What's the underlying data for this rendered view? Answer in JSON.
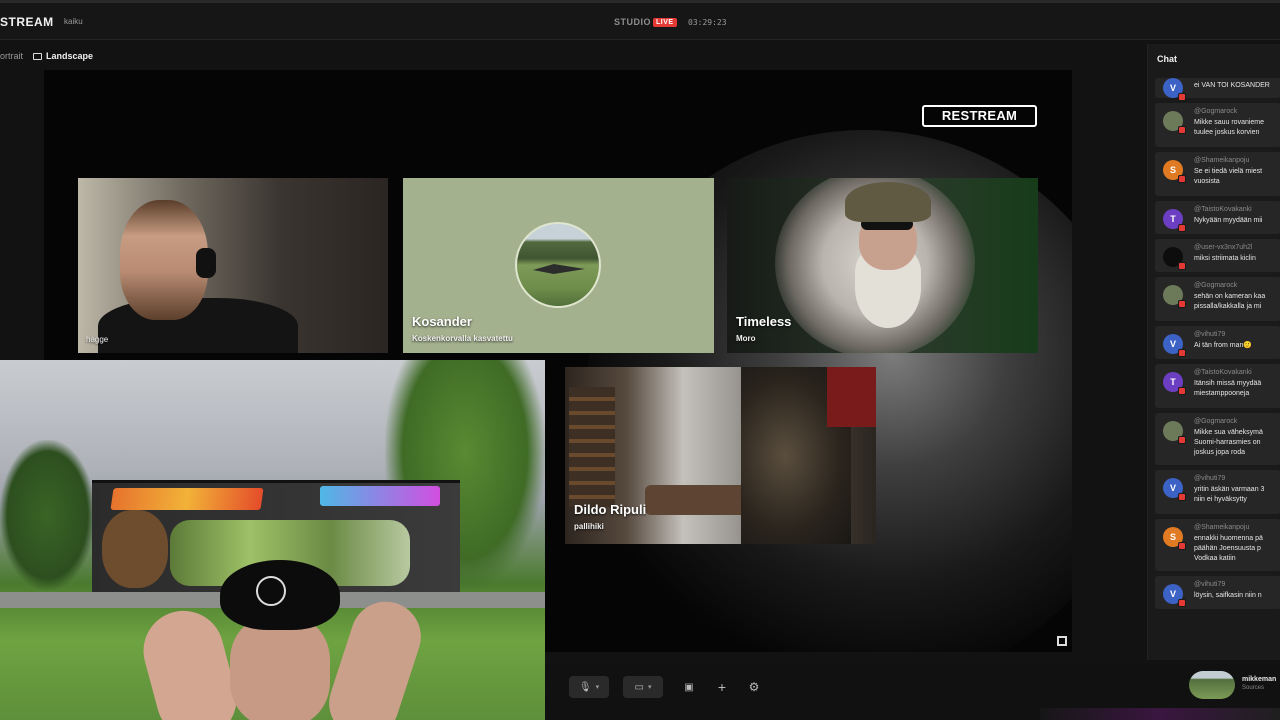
{
  "header": {
    "brand": "STREAM",
    "channel": "kaiku",
    "studio_label": "STUDIO",
    "live_badge": "LIVE",
    "timer": "03:29:23"
  },
  "layout_toggle": {
    "portrait_label": "ortrait",
    "landscape_label": "Landscape",
    "selected": "Landscape"
  },
  "stage": {
    "watermark": "RESTREAM",
    "participants": [
      {
        "name": "hagge",
        "subtitle": ""
      },
      {
        "name": "Kosander",
        "subtitle": "Koskenkorvalla kasvatettu"
      },
      {
        "name": "Timeless",
        "subtitle": "Moro"
      },
      {
        "name": "Dildo Ripuli",
        "subtitle": "pallihiki"
      }
    ]
  },
  "controls": {
    "mic_icon": "microphone-icon",
    "camera_icon": "camera-icon",
    "share_icon": "screen-share-icon",
    "add_icon": "plus-icon",
    "settings_icon": "gear-icon"
  },
  "chat": {
    "title": "Chat",
    "messages": [
      {
        "user": "",
        "text": "ei VAN TOI KOSANDER",
        "avatar": "V",
        "color": "#3b62c4"
      },
      {
        "user": "@Gogmarock",
        "text": "Mikke sauu rovanieme\ntuulee joskus korvien",
        "avatar": "",
        "color": "#6c7a5a"
      },
      {
        "user": "@Shameikanpoju",
        "text": "Se ei tiedä vielä miest\nvuosista",
        "avatar": "S",
        "color": "#e07b24"
      },
      {
        "user": "@TaistoKovakanki",
        "text": "Nykyään myydään mii",
        "avatar": "T",
        "color": "#6c3fc2"
      },
      {
        "user": "@user-vx3nx7uh2l",
        "text": "miksi striimata kiclin",
        "avatar": "",
        "color": "#0d0d0d"
      },
      {
        "user": "@Gogmarock",
        "text": "sehän on kameran kaa\npissalla/kakkalla ja mi",
        "avatar": "",
        "color": "#6c7a5a"
      },
      {
        "user": "@vihuti79",
        "text": "Ai tän from man🙂",
        "avatar": "V",
        "color": "#3b62c4"
      },
      {
        "user": "@TaistoKovakanki",
        "text": "Itänsih missä myydää\nmiestamppooneja",
        "avatar": "T",
        "color": "#6c3fc2"
      },
      {
        "user": "@Gogmarock",
        "text": "Mikke sua väheksymä\nSuomi-harrasmies on\njoskus jopa roda",
        "avatar": "",
        "color": "#6c7a5a"
      },
      {
        "user": "@vihuti79",
        "text": "yritin äskän varmaan 3\nniin ei hyväksytty",
        "avatar": "V",
        "color": "#3b62c4"
      },
      {
        "user": "@Shameikanpoju",
        "text": "ennakki huomenna pä\npäähän Joensuusta p\nVodkaa katiin",
        "avatar": "S",
        "color": "#e07b24"
      },
      {
        "user": "@vihuti79",
        "text": "löysin, saifkasin niin n",
        "avatar": "V",
        "color": "#3b62c4"
      }
    ]
  },
  "source_preview": {
    "name": "mikkeman",
    "sub": "Sources"
  },
  "colors": {
    "live": "#e53935",
    "background": "#121212",
    "panel": "#1a1a1a"
  }
}
